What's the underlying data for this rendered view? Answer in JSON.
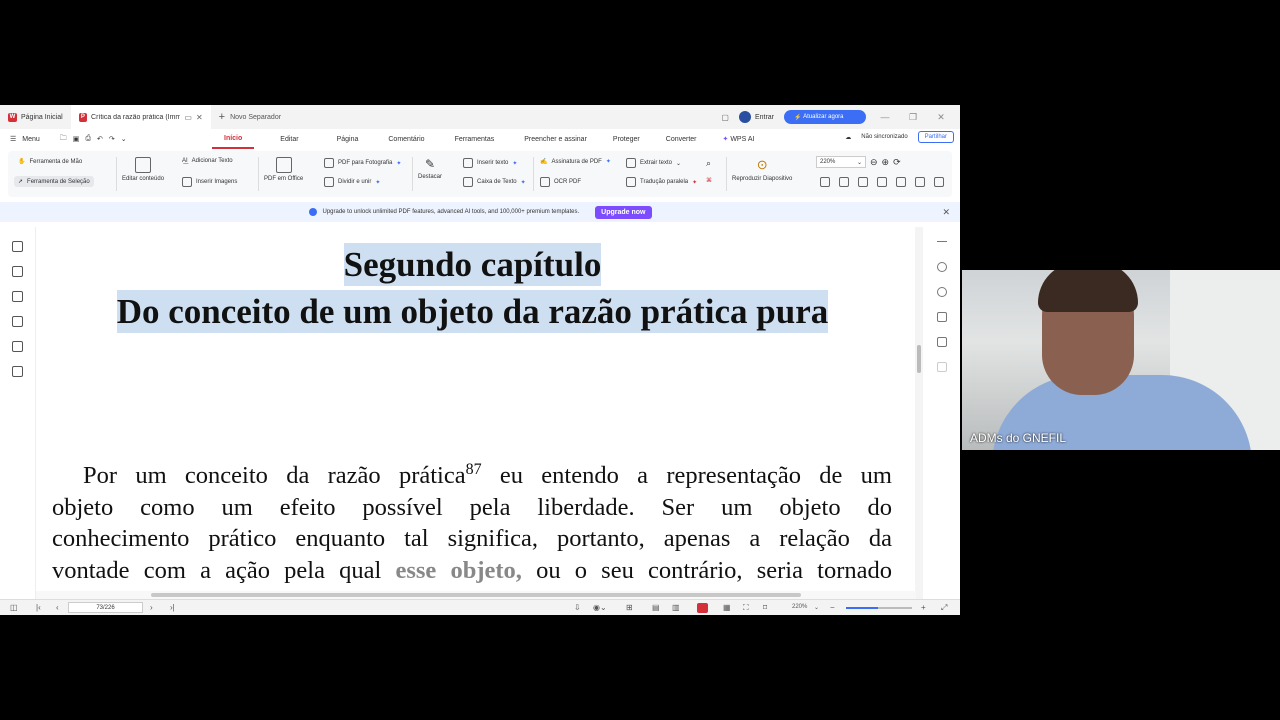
{
  "titlebar": {
    "home_tab": "Página Inicial",
    "doc_tab": "Crítica da razão prática (Immanuel K",
    "new_tab": "Novo Separador",
    "signin": "Entrar",
    "update": "Atualizar agora"
  },
  "menubar": {
    "menu": "Menu",
    "tabs": [
      "Início",
      "Editar",
      "Página",
      "Comentário",
      "Ferramentas",
      "Preencher e assinar",
      "Proteger",
      "Converter",
      "WPS AI"
    ],
    "sync": "Não sincronizado",
    "share": "Partilhar"
  },
  "ribbon": {
    "hand_tool": "Ferramenta de Mão",
    "select_tool": "Ferramenta de Seleção",
    "edit_content": "Editar conteúdo",
    "add_text": "Adicionar Texto",
    "insert_images": "Inserir Imagens",
    "pdf_to_office": "PDF em Office",
    "pdf_to_photo": "PDF para Fotografia",
    "split_merge": "Dividir e unir",
    "highlight": "Destacar",
    "insert_text": "Inserir texto",
    "text_box": "Caixa de Texto",
    "pdf_signature": "Assinatura de PDF",
    "ocr_pdf": "OCR PDF",
    "extract_text": "Extrair texto",
    "parallel_translation": "Tradução paralela",
    "play_slideshow": "Reproduzir Diapositivo",
    "zoom": "220%"
  },
  "banner": {
    "text": "Upgrade to unlock unlimited PDF features, advanced AI tools, and 100,000+ premium templates.",
    "button": "Upgrade now"
  },
  "document": {
    "heading1": "Segundo capítulo",
    "heading2": "Do conceito de um objeto da razão prática pura",
    "line1_a": "Por um conceito da razão prática",
    "footnote": "87",
    "line1_b": " eu entendo a representação de um",
    "line2": "objeto como um efeito possível pela liberdade. Ser um objeto do",
    "line3": "conhecimento prático enquanto tal significa, portanto, apenas a relação da",
    "line4_a": "vontade com a ação pela qual ",
    "line4_grey": "esse objeto,",
    "line4_b": " ou o seu contrário, seria tornado"
  },
  "statusbar": {
    "page": "73/226",
    "zoom": "220%"
  },
  "webcam": {
    "label": "ADMs do GNEFIL"
  },
  "colors": {
    "accent": "#d4303a",
    "primary_blue": "#3b6ef5",
    "highlight": "#cfdff2",
    "upgrade_purple": "#7c4dff"
  }
}
